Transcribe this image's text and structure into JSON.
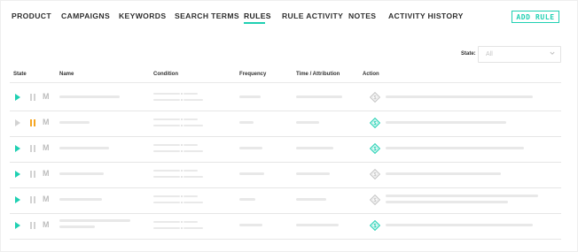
{
  "tabs": [
    {
      "label": "PRODUCT",
      "active": false
    },
    {
      "label": "CAMPAIGNS",
      "active": false
    },
    {
      "label": "KEYWORDS",
      "active": false
    },
    {
      "label": "SEARCH TERMS",
      "active": false
    },
    {
      "label": "RULES",
      "active": true
    },
    {
      "label": "RULE ACTIVITY",
      "active": false
    },
    {
      "label": "NOTES",
      "active": false
    },
    {
      "label": "ACTIVITY HISTORY",
      "active": false
    }
  ],
  "add_rule_label": "ADD RULE",
  "filter": {
    "label": "State:",
    "value": "All"
  },
  "table": {
    "headers": [
      "State",
      "Name",
      "Condition",
      "Frequency",
      "Time / Attribution",
      "Action"
    ],
    "rows": [
      {
        "play_active": true,
        "pause_active": false,
        "m_label": "M",
        "action_status": "inactive"
      },
      {
        "play_active": false,
        "pause_active": true,
        "m_label": "M",
        "action_status": "active"
      },
      {
        "play_active": true,
        "pause_active": false,
        "m_label": "M",
        "action_status": "active"
      },
      {
        "play_active": true,
        "pause_active": false,
        "m_label": "M",
        "action_status": "inactive"
      },
      {
        "play_active": true,
        "pause_active": false,
        "m_label": "M",
        "action_status": "inactive"
      },
      {
        "play_active": true,
        "pause_active": false,
        "m_label": "M",
        "action_status": "active"
      }
    ]
  },
  "colors": {
    "accent": "#1fd0b2",
    "pause_active": "#f5a623",
    "muted": "#d2d2d2"
  },
  "icons": {
    "action": "diamond-dollar-icon",
    "dropdown": "chevron-down-icon"
  }
}
